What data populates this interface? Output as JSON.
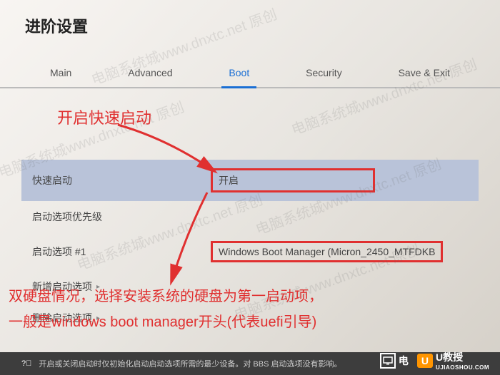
{
  "page_title": "进阶设置",
  "tabs": {
    "main": "Main",
    "advanced": "Advanced",
    "boot": "Boot",
    "security": "Security",
    "save_exit": "Save & Exit"
  },
  "rows": {
    "fast_boot": {
      "label": "快速启动",
      "value": "开启"
    },
    "boot_priority": {
      "label": "启动选项优先级"
    },
    "boot_option_1": {
      "label": "启动选项 #1",
      "value": "Windows Boot Manager (Micron_2450_MTFDKB"
    },
    "add_option": {
      "label": "新增启动选项"
    },
    "delete_option": {
      "label": "删除启动选项"
    }
  },
  "annotations": {
    "a1": "开启快速启动",
    "a2_line1": "双硬盘情况，选择安装系统的硬盘为第一启动项，",
    "a2_line2": "一般是windows boot manager开头(代表uefi引导)"
  },
  "help_text": "开启或关闭启动时仅初始化启动启动选项所需的最少设备。对 BBS 启动选项没有影响。",
  "watermark": "电脑系统城www.dnxtc.net 原创",
  "logos": {
    "brand1": "电",
    "brand2_letter": "U",
    "brand2_text": "U教授",
    "brand2_sub": "UJIAOSHOU.COM"
  }
}
